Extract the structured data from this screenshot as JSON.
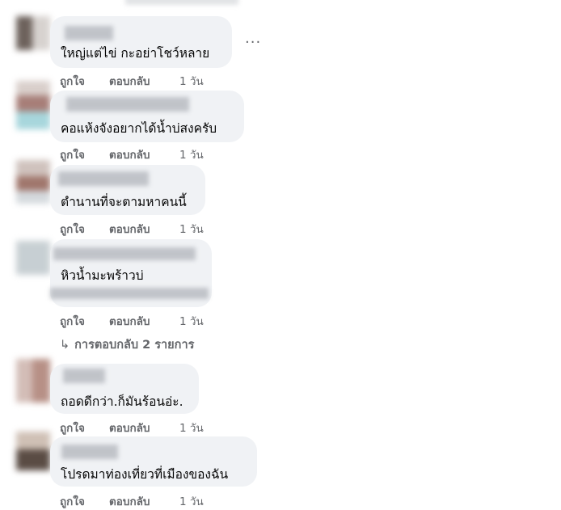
{
  "comments": [
    {
      "text": "ใหญ่แต่ไข่ กะอย่าโชว์หลาย",
      "like": "ถูกใจ",
      "reply": "ตอบกลับ",
      "time": "1 วัน"
    },
    {
      "text": "คอแห้งจังอยากได้น้ำบ่สงครับ",
      "like": "ถูกใจ",
      "reply": "ตอบกลับ",
      "time": "1 วัน"
    },
    {
      "text": "ตำนานที่จะตามหาคนนี้",
      "like": "ถูกใจ",
      "reply": "ตอบกลับ",
      "time": "1 วัน"
    },
    {
      "text": "หิวน้ำมะพร้าวบ่",
      "like": "ถูกใจ",
      "reply": "ตอบกลับ",
      "time": "1 วัน"
    },
    {
      "text": "ถอดดีกว่า.ก็มันร้อนอ่ะ.",
      "like": "ถูกใจ",
      "reply": "ตอบกลับ",
      "time": "1 วัน"
    },
    {
      "text": "โปรดมาท่องเที่ยวที่เมืองของฉัน",
      "like": "ถูกใจ",
      "reply": "ตอบกลับ",
      "time": "1 วัน"
    }
  ],
  "replies_link": {
    "arrow": "↳",
    "label": "การตอบกลับ 2 รายการ"
  },
  "more_icon": {
    "glyph": "···",
    "icon": "more-horizontal-icon"
  },
  "colors": {
    "bubble": "#f0f2f5",
    "meta": "#65676b",
    "text": "#050505"
  }
}
